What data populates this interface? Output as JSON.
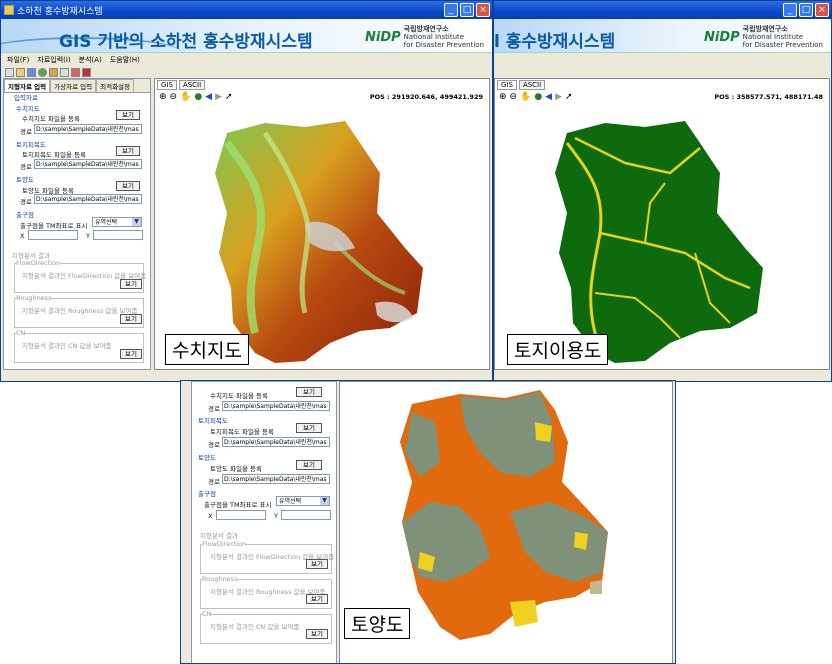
{
  "window": {
    "title": "소하천 홍수방재시스템",
    "banner_title": "GIS 기반의 소하천 홍수방재시스템",
    "banner_title_partial": "l 홍수방재시스템",
    "logo_mark": "NiDP",
    "logo_name": "국립방재연구소",
    "logo_sub1": "National Institute",
    "logo_sub2": "for Disaster Prevention"
  },
  "menu": [
    "파일(F)",
    "자료입력(I)",
    "분석(A)",
    "도움말(H)"
  ],
  "left_tabs": [
    "지형자료 입력",
    "가상자료 입력",
    "최적화설정"
  ],
  "input_section": "입력자료",
  "dem": {
    "group": "수치지도",
    "label": "수치지도 파일을 등록",
    "button": "보기",
    "path_label": "경로",
    "path": "D:\\sample\\SampleData\\내린천\\mas"
  },
  "landuse": {
    "group": "토지피복도",
    "label": "토지피복도 파일을 등록",
    "button": "보기",
    "path_label": "경로",
    "path": "D:\\sample\\SampleData\\내린천\\mas"
  },
  "soil": {
    "group": "토양도",
    "label": "토양도 파일을 등록",
    "button": "보기",
    "path_label": "경로",
    "path": "D:\\sample\\SampleData\\내린천\\mas"
  },
  "outlet": {
    "group": "출구점",
    "label": "출구점을 TM좌표로 표시",
    "select": "유역선택",
    "x_label": "X",
    "y_label": "Y"
  },
  "analysis": {
    "title": "지형분석 결과",
    "flow_group": "FlowDirection",
    "flow_text": "지형분석 결과인 FlowDirection 값을 보여줌",
    "rough_group": "Roughness",
    "rough_text": "지형분석 결과인 Roughness 값을 보여줌",
    "cn_group": "CN",
    "cn_text": "지형분석 결과인  CN 값을 보여줌",
    "button": "보기"
  },
  "map_tabs": [
    "GIS",
    "ASCII"
  ],
  "pos_left": "POS : 291920.646, 499421.929",
  "pos_right": "POS : 358577.571, 488171.48",
  "captions": {
    "dem": "수치지도",
    "landuse": "토지이용도",
    "soil": "토양도"
  },
  "colors": {
    "title_bar": "#0a48c8",
    "forest": "#0d6a0d",
    "urban": "#e8d21c",
    "soil_orange": "#e16a0e",
    "soil_gray": "#7f9178"
  }
}
